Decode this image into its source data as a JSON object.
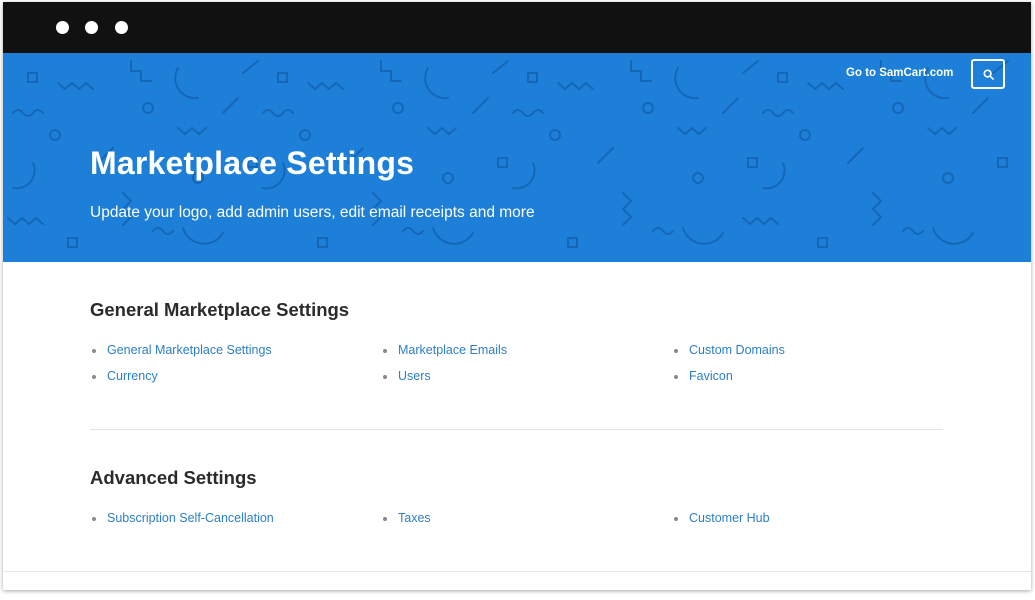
{
  "window": {
    "controls": [
      "window-dot",
      "window-dot",
      "window-dot"
    ]
  },
  "header": {
    "title": "Marketplace Settings",
    "subtitle": "Update your logo, add admin users, edit email receipts and more",
    "top_link": "Go to SamCart.com",
    "search_icon": "search-icon",
    "background_color": "#1d7fd8"
  },
  "sections": [
    {
      "title": "General Marketplace Settings",
      "links": [
        "General Marketplace Settings",
        "Marketplace Emails",
        "Custom Domains",
        "Currency",
        "Users",
        "Favicon"
      ]
    },
    {
      "title": "Advanced Settings",
      "links": [
        "Subscription Self-Cancellation",
        "Taxes",
        "Customer Hub"
      ]
    }
  ],
  "colors": {
    "link": "#2d7ec8",
    "heading": "#2b2b2b",
    "titlebar": "#111111"
  }
}
